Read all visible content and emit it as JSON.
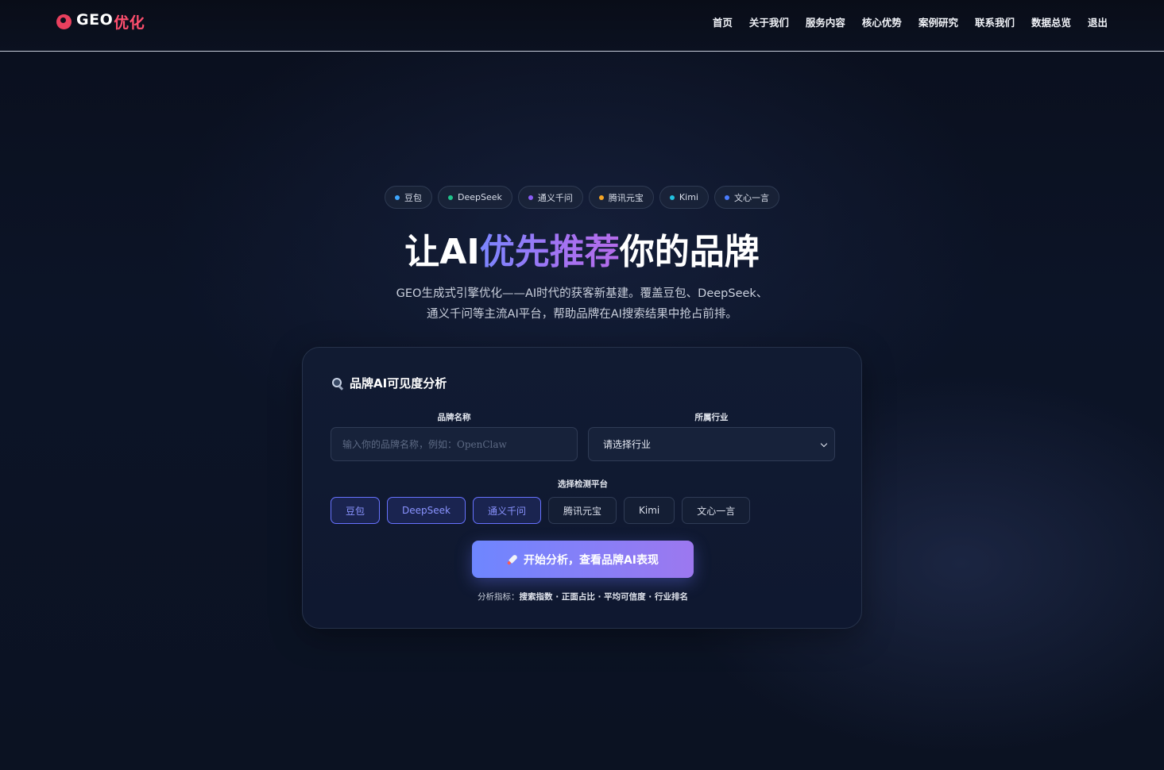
{
  "nav": {
    "logo_main": "GEO",
    "logo_cn": "优化",
    "links": [
      "首页",
      "关于我们",
      "服务内容",
      "核心优势",
      "案例研究",
      "联系我们",
      "数据总览",
      "退出"
    ]
  },
  "hero": {
    "pills": [
      {
        "label": "豆包",
        "color": "#3ea6ff"
      },
      {
        "label": "DeepSeek",
        "color": "#1fc28a"
      },
      {
        "label": "通义千问",
        "color": "#8a5cf6"
      },
      {
        "label": "腾讯元宝",
        "color": "#f5a524"
      },
      {
        "label": "Kimi",
        "color": "#22c1e0"
      },
      {
        "label": "文心一言",
        "color": "#4a7dff"
      }
    ],
    "title_pre": "让AI",
    "title_highlight": "优先推荐",
    "title_post": "你的品牌",
    "subtitle_line1": "GEO生成式引擎优化——AI时代的获客新基建。覆盖豆包、DeepSeek、",
    "subtitle_line2": "通义千问等主流AI平台，帮助品牌在AI搜索结果中抢占前排。"
  },
  "card": {
    "title": "品牌AI可见度分析",
    "brand_label": "品牌名称",
    "brand_placeholder": "输入你的品牌名称，例如：OpenClaw",
    "industry_label": "所属行业",
    "industry_value": "请选择行业",
    "platform_label": "选择检测平台",
    "platforms": [
      {
        "label": "豆包",
        "active": true
      },
      {
        "label": "DeepSeek",
        "active": true
      },
      {
        "label": "通义千问",
        "active": true
      },
      {
        "label": "腾讯元宝",
        "active": false
      },
      {
        "label": "Kimi",
        "active": false
      },
      {
        "label": "文心一言",
        "active": false
      }
    ],
    "cta_label": "开始分析，查看品牌AI表现",
    "metrics_prefix": "分析指标：",
    "metrics_items": "搜索指数 · 正面占比 · 平均可信度 · 行业排名"
  }
}
